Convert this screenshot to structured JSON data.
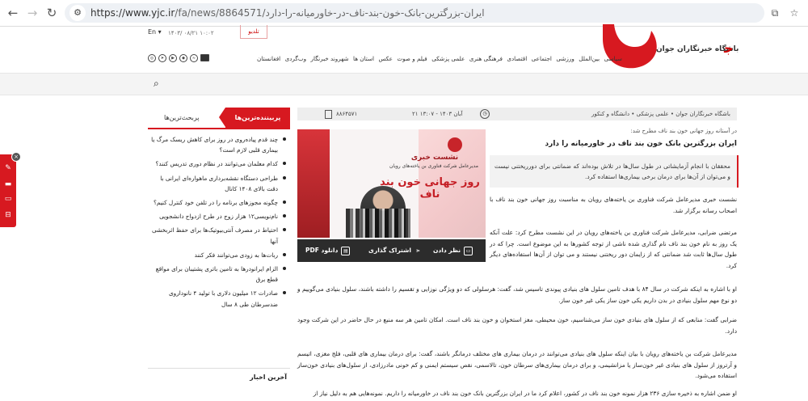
{
  "browser": {
    "url_host": "https://www.yjc.ir",
    "url_path": "/fa/news/8864571/ایران-بزرگترین-بانک-خون-بند-ناف-در-خاورمیانه-را-دارد"
  },
  "header": {
    "lang": "En",
    "datetime": "۱۴۰۳/ ۰۸/۲۱  ۱۰:۰۲",
    "video_label": "تلدیو",
    "logo_text": "باشگاه خبرنگاران جوان",
    "nav": [
      "سیاسی",
      "بین‌الملل",
      "ورزشی",
      "اجتماعی",
      "اقتصادی",
      "فرهنگی هنری",
      "علمی پزشکی",
      "فیلم و صوت",
      "عکس",
      "استان ها",
      "شهروند خبرنگار",
      "وب‌گردی",
      "افغانستان"
    ]
  },
  "sidebar": {
    "tab_active": "پربیننده‌ترین‌ها",
    "tab_other": "پربحث‌ترین‌ها",
    "items": [
      "چند قدم پیاده‌روی در روز برای کاهش ریسک مرگ یا بیماری قلبی لازم است؟",
      "کدام معلمان می‌توانند در نظام دوری تدریس کنند؟",
      "طراحی دستگاه نقشه‌برداری ماهواره‌ای ایرانی با دقت بالای ۱۴۰۸ کانال",
      "چگونه مجوزهای برنامه را در تلفن خود کنترل کنیم؟",
      "نام‌نویسی۱۲ هزار زوج در طرح ازدواج دانشجویی",
      "احتیاط در مصرف آنتی‌بیوتیک‌ها برای حفظ اثربخشی آنها",
      "ربات‌ها به زودی می‌توانند فکر کنند",
      "الزام ایرانودرها به تامین باتری پشتیبان برای مواقع قطع برق",
      "صادرات ۱۲ میلیون دلاری با تولید ۴ نانوداروی ضدسرطان طی ۸ سال"
    ],
    "box2_title": "آخرین اخبار"
  },
  "article": {
    "breadcrumb": "باشگاه خبرنگاران جوان  •  علمی پزشکی  •  دانشگاه و کنکور",
    "date": "۲۱ آبان ۱۴۰۳ - ۱۳:۰۷",
    "news_id": "۸۸۶۴۵۷۱",
    "lead_up": "در آستانه روز جهانی خون بند ناف مطرح شد:",
    "headline": "ایران بزرگترین بانک خون بند ناف در خاورمیانه را دارد",
    "summary": "محققان با انجام آزمایشاتی در طول سال‌ها در تلاش بوده‌اند که ضمانتی برای دورریختنی نیست و می‌توان از آن‌ها برای درمان برخی بیماری‌ها استفاده کرد.",
    "image": {
      "t1": "نشست خبری",
      "t2": "مدیرعامل شرکت فناوری بن یاخته‌های رویان",
      "t3": "روز جهانی خون بند ناف"
    },
    "actions": {
      "comment": "نظر دادن",
      "share": "اشتراک گذاری",
      "pdf": "دانلود PDF"
    },
    "side_paragraphs": [
      "نشست خبری مدیرعامل شرکت فناوری بن یاخته‌های رویان به مناسبت روز جهانی خون بند ناف با اصحاب رسانه برگزار شد.",
      "مرتضی ضرابی، مدیرعامل شرکت فناوری بن یاخته‌های رویان در این نشست مطرح کرد: علت آنکه یک روز به نام خون بند ناف نام گذاری شده ناشی از توجه کشورها به این موضوع است. چرا که در طول سال‌ها ثابت شد ضمانتی که از زایمان دور ریختنی نیستند و می توان از آن‌ها استفاده‌های دیگر کرد."
    ],
    "paragraphs": [
      "او با اشاره به اینکه شرکت در سال ۸۴ با هدف تامین سلول های بنیادی پیوندی تاسیس شد، گفت: هرسلولی که دو ویژگی نوزایی و تقسیم را داشته باشند، سلول بنیادی می‌گوییم و دو نوع مهم سلول بنیادی در بدن داریم یکی خون ساز یکی غیر خون ساز.",
      "ضرابی گفت: منابعی که از سلول های بنیادی خون ساز می‌شناسیم، خون محیطی، مغز استخوان و خون بند ناف است. امکان تامین هر سه منبع در حال حاضر در این شرکت وجود دارد.",
      "مدیرعامل شرکت بن یاخته‌های رویان با بیان اینکه سلول های بنیادی می‌توانند در درمان بیماری های مختلف درمانگر باشند، گفت: برای درمان بیماری های قلبی، فلج مغزی، اتیسم و آرتروز از سلول های بنیادی غیر خون‌ساز یا مزانشیمی، و برای درمان بیماری‌های سرطان خون، تالاسمی، نقص سیستم ایمنی و کم خونی مادرزادی، از سلول‌های بنیادی خون‌ساز استفاده می‌شود.",
      "او ضمن اشاره به ذخیره سازی ۲۳۶ هزار نمونه خون بند ناف در کشور، اعلام کرد ما در ایران بزرگترین بانک خون بند ناف در خاورمیانه را داریم. نمونه‌هایی هم به دلیل نیاز از"
    ]
  }
}
